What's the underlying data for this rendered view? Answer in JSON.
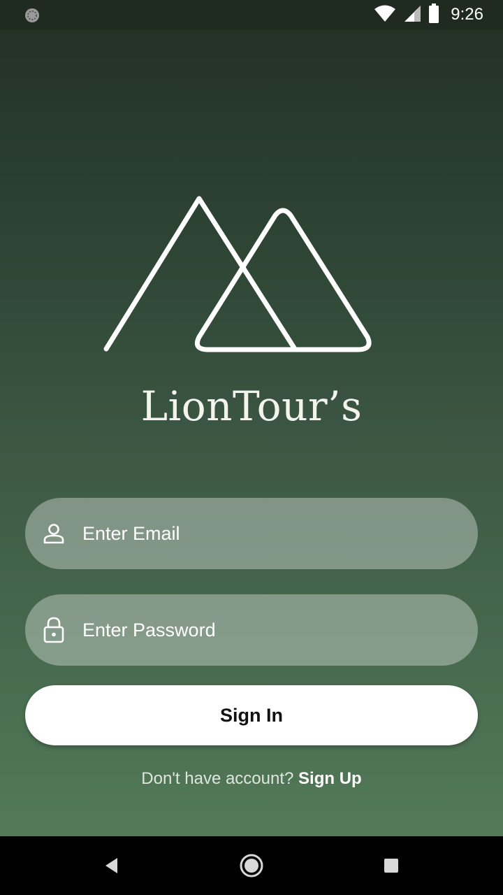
{
  "status_bar": {
    "time": "9:26",
    "icons": [
      "sync-icon",
      "wifi-icon",
      "signal-icon",
      "battery-icon"
    ]
  },
  "brand": {
    "logo_icon": "mountains-logo-icon",
    "name": "LionTour’s"
  },
  "form": {
    "email": {
      "placeholder": "Enter Email",
      "value": "",
      "icon": "person-icon"
    },
    "password": {
      "placeholder": "Enter Password",
      "value": "",
      "icon": "lock-icon"
    },
    "signin_label": "Sign In",
    "signup_prompt": "Don't have account?",
    "signup_link": "Sign Up"
  },
  "nav_bar": {
    "icons": [
      "back-icon",
      "home-icon",
      "recents-icon"
    ]
  },
  "colors": {
    "background_top": "#233326",
    "background_bottom": "#527a58",
    "field_fill": "rgba(255,255,255,0.34)",
    "button_fill": "#ffffff"
  }
}
